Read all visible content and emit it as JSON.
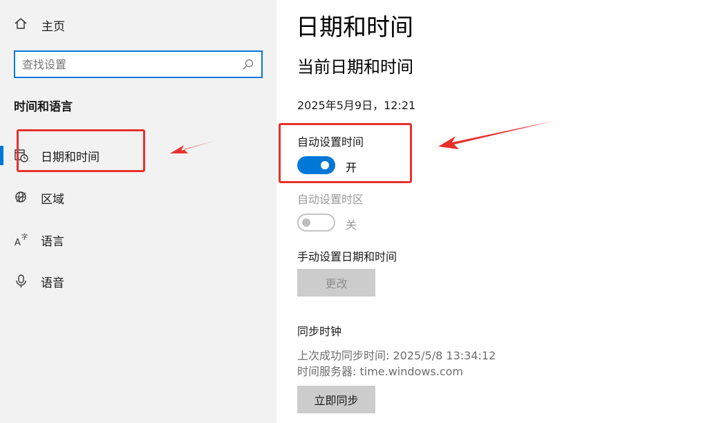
{
  "sidebar": {
    "home_label": "主页",
    "search_placeholder": "查找设置",
    "section_title": "时间和语言",
    "items": [
      {
        "label": "日期和时间",
        "icon": "calendar-clock-icon",
        "selected": true
      },
      {
        "label": "区域",
        "icon": "globe-icon",
        "selected": false
      },
      {
        "label": "语言",
        "icon": "language-icon",
        "selected": false
      },
      {
        "label": "语音",
        "icon": "microphone-icon",
        "selected": false
      }
    ]
  },
  "main": {
    "title": "日期和时间",
    "subtitle": "当前日期和时间",
    "current_datetime": "2025年5月9日，12:21",
    "auto_time": {
      "label": "自动设置时间",
      "state": "开",
      "on": true
    },
    "auto_timezone": {
      "label": "自动设置时区",
      "state": "关",
      "on": false
    },
    "manual": {
      "label": "手动设置日期和时间",
      "button": "更改"
    },
    "sync": {
      "title": "同步时钟",
      "last_sync": "上次成功同步时间: 2025/5/8 13:34:12",
      "server": "时间服务器: time.windows.com",
      "button": "立即同步"
    }
  },
  "colors": {
    "accent": "#0078d7",
    "annotation": "#e8302a",
    "sidebar_bg": "#f2f2f2"
  }
}
